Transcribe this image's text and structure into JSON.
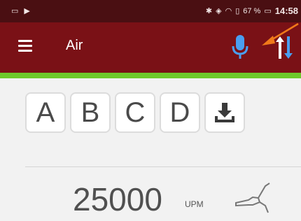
{
  "statusbar": {
    "left_icons": [
      "image-icon",
      "play-icon"
    ],
    "right_icons": [
      "bluetooth-icon",
      "vibrate-icon",
      "wifi-icon",
      "sim-icon"
    ],
    "battery_percent": "67 %",
    "time": "14:58"
  },
  "appbar": {
    "title": "Air"
  },
  "buttons": {
    "a": "A",
    "b": "B",
    "c": "C",
    "d": "D"
  },
  "speed": {
    "value": "25000",
    "unit": "UPM"
  },
  "colors": {
    "statusbar": "#4a0f12",
    "appbar": "#7a1116",
    "accent_green": "#6ec92b",
    "mic_blue": "#4a9ef0",
    "annotation_arrow": "#f07a1a"
  }
}
